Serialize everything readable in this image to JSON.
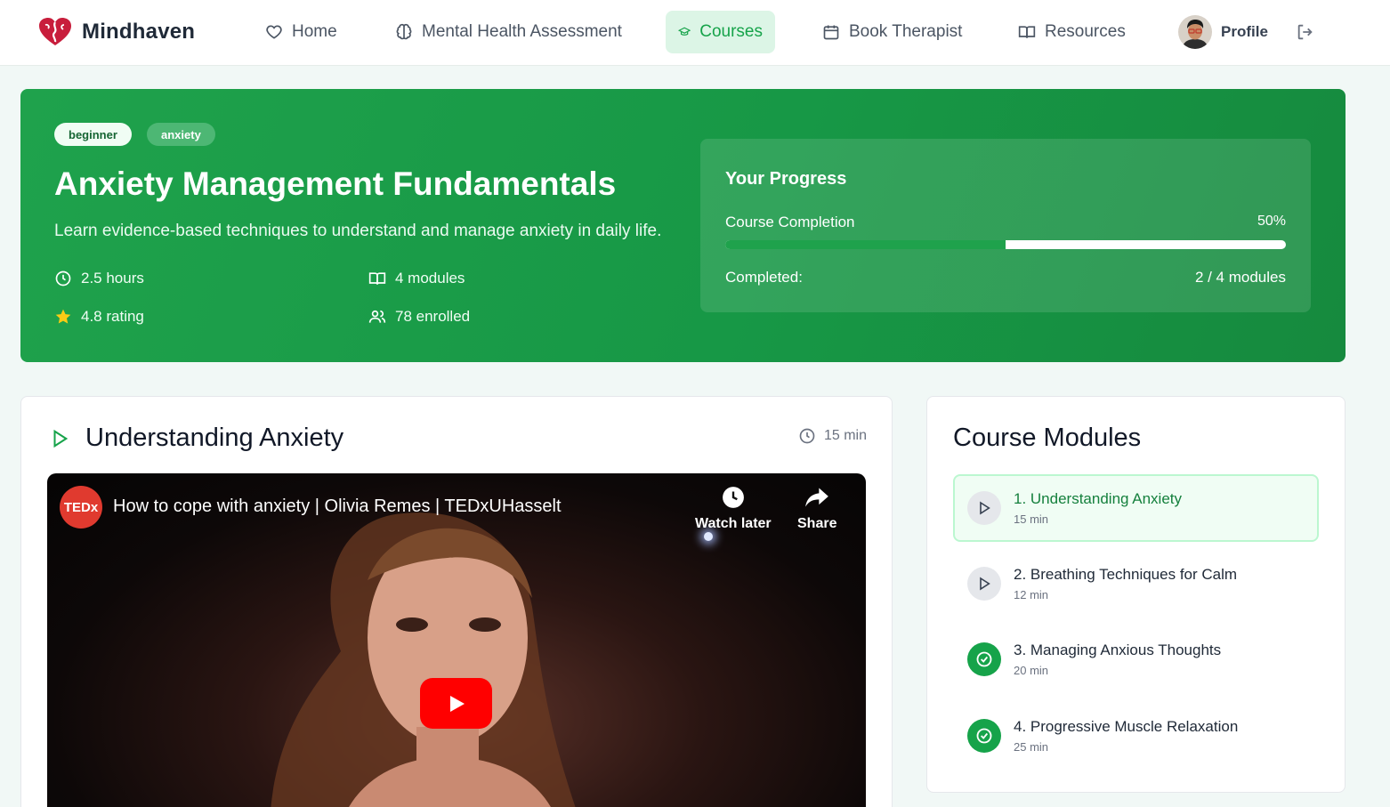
{
  "nav": {
    "brand": "Mindhaven",
    "items": [
      {
        "label": "Home",
        "icon": "heart-icon"
      },
      {
        "label": "Mental Health Assessment",
        "icon": "brain-icon"
      },
      {
        "label": "Courses",
        "icon": "graduation-cap-icon",
        "active": true
      },
      {
        "label": "Book Therapist",
        "icon": "calendar-icon"
      },
      {
        "label": "Resources",
        "icon": "book-open-icon"
      }
    ],
    "profile_label": "Profile"
  },
  "course": {
    "tags": [
      "beginner",
      "anxiety"
    ],
    "title": "Anxiety Management Fundamentals",
    "description": "Learn evidence-based techniques to understand and manage anxiety in daily life.",
    "duration": "2.5 hours",
    "modules_count": "4 modules",
    "rating": "4.8 rating",
    "enrolled": "78 enrolled"
  },
  "progress": {
    "title": "Your Progress",
    "completion_label": "Course Completion",
    "completion_pct": "50%",
    "completion_fraction": 0.5,
    "completed_label": "Completed:",
    "completed_value": "2 / 4 modules"
  },
  "lesson": {
    "title": "Understanding Anxiety",
    "duration": "15 min",
    "video": {
      "channel_badge": "TEDx",
      "title": "How to cope with anxiety | Olivia Remes | TEDxUHasselt",
      "watch_later": "Watch later",
      "share": "Share"
    }
  },
  "modules_panel": {
    "title": "Course Modules",
    "modules": [
      {
        "title": "1. Understanding Anxiety",
        "duration": "15 min",
        "status": "active"
      },
      {
        "title": "2. Breathing Techniques for Calm",
        "duration": "12 min",
        "status": "todo"
      },
      {
        "title": "3. Managing Anxious Thoughts",
        "duration": "20 min",
        "status": "done"
      },
      {
        "title": "4. Progressive Muscle Relaxation",
        "duration": "25 min",
        "status": "done"
      }
    ]
  },
  "colors": {
    "brand_green": "#16a34a",
    "hero_green": "#1fa24c",
    "active_nav_bg": "#dcf5e6",
    "youtube_red": "#ff0000"
  }
}
